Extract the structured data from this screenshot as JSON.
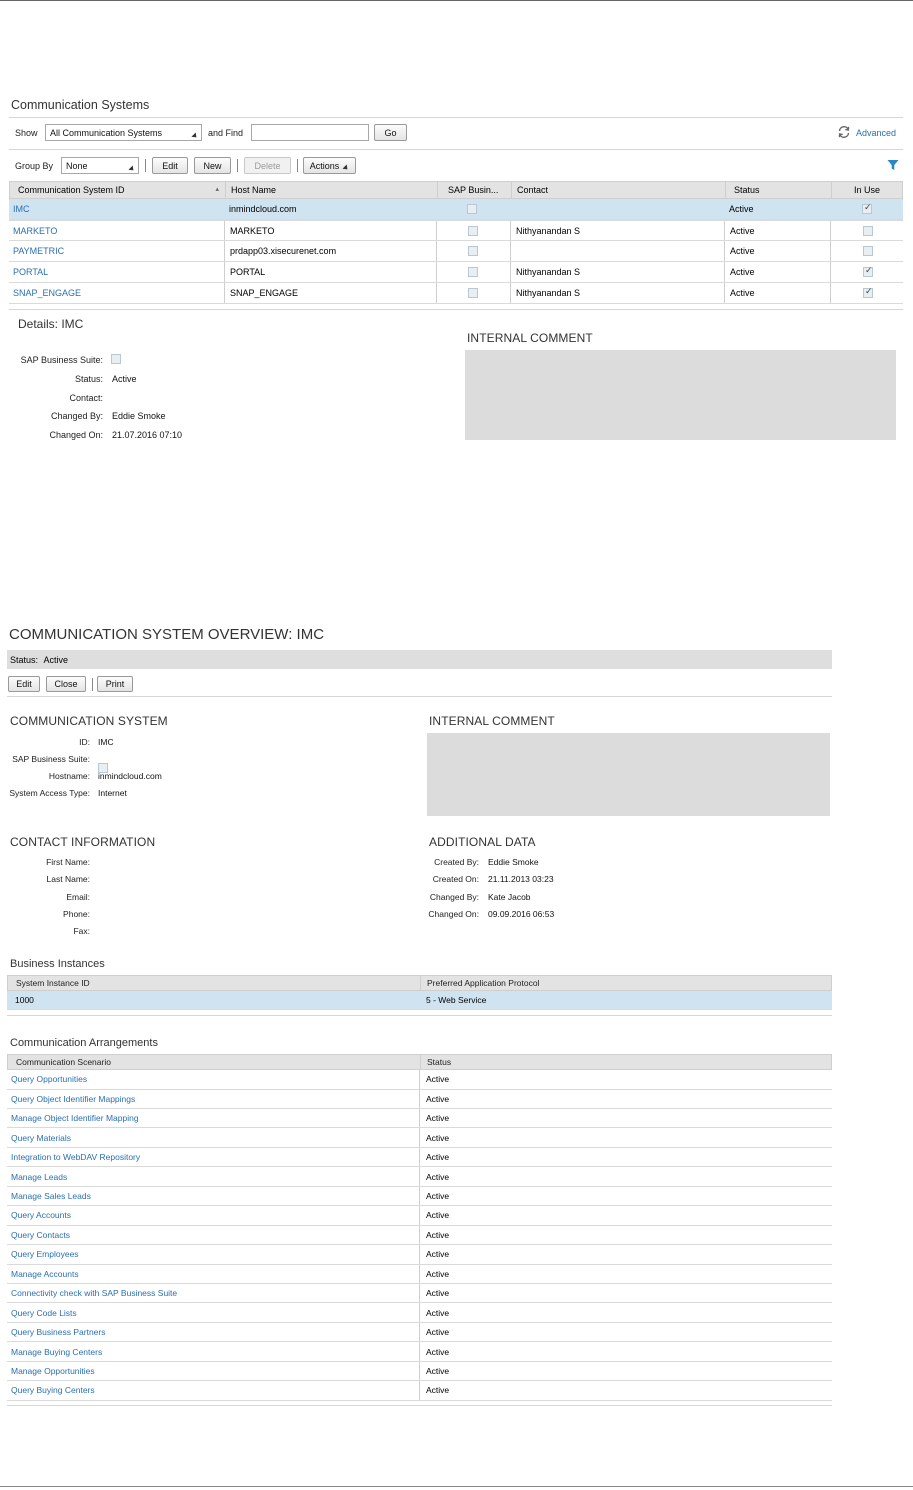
{
  "systems_list": {
    "title": "Communication Systems",
    "show_label": "Show",
    "show_value": "All Communication Systems",
    "find_label": "and Find",
    "find_value": "",
    "go_label": "Go",
    "advanced_label": "Advanced",
    "group_by_label": "Group By",
    "group_by_value": "None",
    "edit_label": "Edit",
    "new_label": "New",
    "delete_label": "Delete",
    "actions_label": "Actions",
    "columns": [
      "Communication System ID",
      "Host Name",
      "SAP Busin...",
      "Contact",
      "Status",
      "In Use"
    ],
    "rows": [
      {
        "id": "IMC",
        "host": "inmindcloud.com",
        "sap_business_suite": false,
        "contact": "",
        "status": "Active",
        "in_use": true,
        "selected": true
      },
      {
        "id": "MARKETO",
        "host": "MARKETO",
        "sap_business_suite": false,
        "contact": "Nithyanandan S",
        "status": "Active",
        "in_use": false,
        "selected": false
      },
      {
        "id": "PAYMETRIC",
        "host": "prdapp03.xisecurenet.com",
        "sap_business_suite": false,
        "contact": "",
        "status": "Active",
        "in_use": false,
        "selected": false
      },
      {
        "id": "PORTAL",
        "host": "PORTAL",
        "sap_business_suite": false,
        "contact": "Nithyanandan S",
        "status": "Active",
        "in_use": true,
        "selected": false
      },
      {
        "id": "SNAP_ENGAGE",
        "host": "SNAP_ENGAGE",
        "sap_business_suite": false,
        "contact": "Nithyanandan S",
        "status": "Active",
        "in_use": true,
        "selected": false
      }
    ]
  },
  "details": {
    "title": "Details: IMC",
    "sap_business_suite_label": "SAP Business Suite:",
    "status_label": "Status:",
    "status_value": "Active",
    "contact_label": "Contact:",
    "contact_value": "",
    "changed_by_label": "Changed By:",
    "changed_by_value": "Eddie Smoke",
    "changed_on_label": "Changed On:",
    "changed_on_value": "21.07.2016 07:10",
    "internal_comment_title": "INTERNAL COMMENT",
    "internal_comment_value": ""
  },
  "overview": {
    "title": "COMMUNICATION SYSTEM OVERVIEW: IMC",
    "status_label": "Status:",
    "status_value": "Active",
    "edit_label": "Edit",
    "close_label": "Close",
    "print_label": "Print",
    "comm_system": {
      "title": "COMMUNICATION SYSTEM",
      "id_label": "ID:",
      "id_value": "IMC",
      "sap_label": "SAP Business Suite:",
      "hostname_label": "Hostname:",
      "hostname_value": "inmindcloud.com",
      "access_label": "System Access Type:",
      "access_value": "Internet"
    },
    "internal_comment_title": "INTERNAL COMMENT",
    "contact_info": {
      "title": "CONTACT INFORMATION",
      "first_name_label": "First Name:",
      "last_name_label": "Last Name:",
      "email_label": "Email:",
      "phone_label": "Phone:",
      "fax_label": "Fax:"
    },
    "additional_data": {
      "title": "ADDITIONAL DATA",
      "created_by_label": "Created By:",
      "created_by_value": "Eddie Smoke",
      "created_on_label": "Created On:",
      "created_on_value": "21.11.2013 03:23",
      "changed_by_label": "Changed By:",
      "changed_by_value": "Kate Jacob",
      "changed_on_label": "Changed On:",
      "changed_on_value": "09.09.2016 06:53"
    },
    "business_instances": {
      "title": "Business Instances",
      "columns": [
        "System Instance ID",
        "Preferred Application Protocol"
      ],
      "rows": [
        {
          "id": "1000",
          "protocol": "5 - Web Service"
        }
      ]
    },
    "arrangements": {
      "title": "Communication Arrangements",
      "columns": [
        "Communication Scenario",
        "Status"
      ],
      "rows": [
        {
          "scenario": "Query Opportunities",
          "status": "Active"
        },
        {
          "scenario": "Query Object Identifier Mappings",
          "status": "Active"
        },
        {
          "scenario": "Manage Object Identifier Mapping",
          "status": "Active"
        },
        {
          "scenario": "Query Materials",
          "status": "Active"
        },
        {
          "scenario": "Integration to WebDAV Repository",
          "status": "Active"
        },
        {
          "scenario": "Manage Leads",
          "status": "Active"
        },
        {
          "scenario": "Manage Sales Leads",
          "status": "Active"
        },
        {
          "scenario": "Query Accounts",
          "status": "Active"
        },
        {
          "scenario": "Query Contacts",
          "status": "Active"
        },
        {
          "scenario": "Query Employees",
          "status": "Active"
        },
        {
          "scenario": "Manage Accounts",
          "status": "Active"
        },
        {
          "scenario": "Connectivity check with SAP Business Suite",
          "status": "Active"
        },
        {
          "scenario": "Query Code Lists",
          "status": "Active"
        },
        {
          "scenario": "Query Business Partners",
          "status": "Active"
        },
        {
          "scenario": "Manage Buying Centers",
          "status": "Active"
        },
        {
          "scenario": "Manage Opportunities",
          "status": "Active"
        },
        {
          "scenario": "Query Buying Centers",
          "status": "Active"
        }
      ]
    }
  },
  "colors": {
    "link": "#2a6fb0",
    "selected_row": "#cfe3f1",
    "header_bg": "#e3e3e3",
    "comment_bg": "#dcdcdc"
  }
}
